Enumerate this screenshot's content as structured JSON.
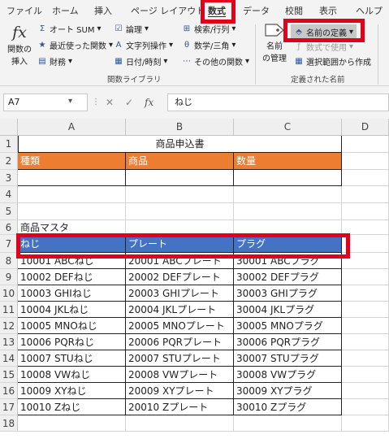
{
  "tabs": [
    "ファイル",
    "ホーム",
    "挿入",
    "ページ レイアウト",
    "数式",
    "データ",
    "校閲",
    "表示",
    "ヘルプ"
  ],
  "ribbon": {
    "fx_glyph": "fx",
    "insert_function": [
      "関数の",
      "挿入"
    ],
    "autosum": "オート SUM",
    "recent": "最近使った関数",
    "financial": "財務",
    "logical": "論理",
    "text": "文字列操作",
    "datetime": "日付/時刻",
    "lookup": "検索/行列",
    "math": "数学/三角",
    "more": "その他の関数",
    "group1": "関数ライブラリ",
    "name_manager": [
      "名前",
      "の管理"
    ],
    "define_name": "名前の定義",
    "use_in_formula": "数式で使用",
    "create_from_selection": "選択範囲から作成",
    "group2": "定義された名前"
  },
  "formula_bar": {
    "name_box": "A7",
    "fx": "fx",
    "formula": "ねじ"
  },
  "columns": [
    "A",
    "B",
    "C",
    "D"
  ],
  "rows": [
    "1",
    "2",
    "3",
    "4",
    "5",
    "6",
    "7",
    "8",
    "9",
    "10",
    "11",
    "12",
    "13",
    "14",
    "15",
    "16",
    "17",
    "18"
  ],
  "cells": {
    "title": "商品申込書",
    "h_kind": "種類",
    "h_product": "商品",
    "h_qty": "数量",
    "master": "商品マスタ",
    "m_a": "ねじ",
    "m_b": "プレート",
    "m_c": "プラグ"
  },
  "data_rows": [
    [
      "10001 ABCねじ",
      "20001 ABCプレート",
      "30001 ABCプラグ"
    ],
    [
      "10002 DEFねじ",
      "20002 DEFプレート",
      "30002 DEFプラグ"
    ],
    [
      "10003 GHIねじ",
      "20003 GHIプレート",
      "30003 GHIプラグ"
    ],
    [
      "10004 JKLねじ",
      "20004 JKLプレート",
      "30004 JKLプラグ"
    ],
    [
      "10005 MNOねじ",
      "20005 MNOプレート",
      "30005 MNOプラグ"
    ],
    [
      "10006 PQRねじ",
      "20006 PQRプレート",
      "30006 PQRプラグ"
    ],
    [
      "10007 STUねじ",
      "20007 STUプレート",
      "30007 STUプラグ"
    ],
    [
      "10008 VWねじ",
      "20008 VWプレート",
      "30008 VWプラグ"
    ],
    [
      "10009 XYねじ",
      "20009 XYプレート",
      "30009 XYプラグ"
    ],
    [
      "10010 Zねじ",
      "20010 Zプレート",
      "30010 Zプラグ"
    ]
  ],
  "colors": {
    "orange": "#ed7d31",
    "blue": "#4472c4",
    "red": "#e3001b"
  }
}
